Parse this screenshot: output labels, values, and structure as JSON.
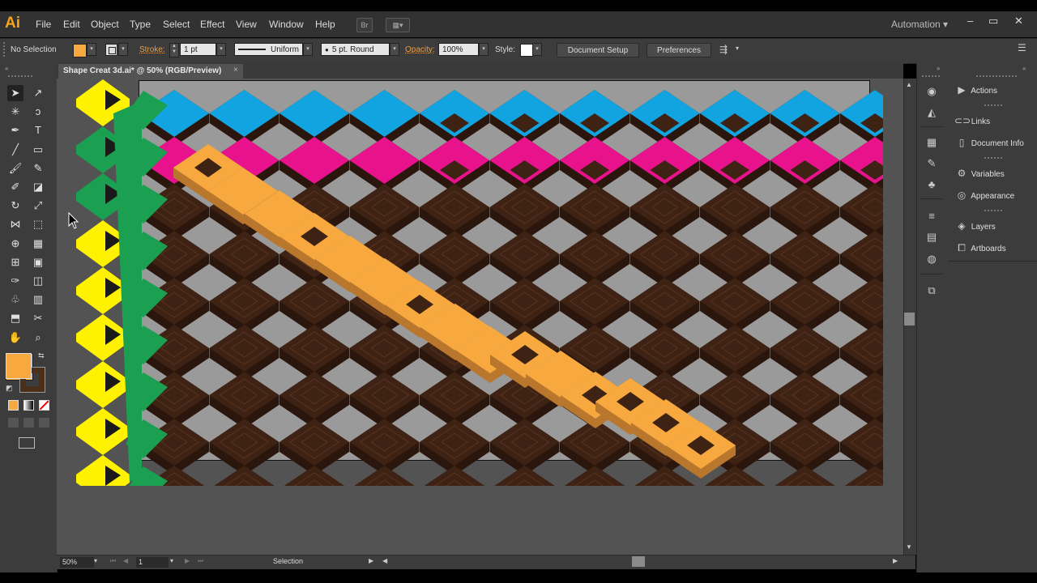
{
  "app": {
    "logo": "Ai"
  },
  "menu": [
    "File",
    "Edit",
    "Object",
    "Type",
    "Select",
    "Effect",
    "View",
    "Window",
    "Help"
  ],
  "menubar_buttons": {
    "bridge": "Br",
    "arrange": "▦▾"
  },
  "workspace": "Automation",
  "window_controls": {
    "minimize": "–",
    "restore": "▭",
    "close": "✕"
  },
  "control_bar": {
    "selection_label": "No Selection",
    "fill_color": "#f7a940",
    "stroke_label": "Stroke:",
    "stroke_weight": "1 pt",
    "profile": "Uniform",
    "brush": "5 pt. Round",
    "opacity_label": "Opacity:",
    "opacity": "100%",
    "style_label": "Style:",
    "document_setup": "Document Setup",
    "preferences": "Preferences"
  },
  "document": {
    "tab_title": "Shape Creat 3d.ai* @ 50% (RGB/Preview)",
    "tab_close": "×"
  },
  "status_bar": {
    "zoom": "50%",
    "artboard_number": "1",
    "tool_status": "Selection"
  },
  "toolbar": {
    "tools": [
      "selection-tool",
      "direct-selection-tool",
      "magic-wand-tool",
      "lasso-tool",
      "pen-tool",
      "type-tool",
      "line-tool",
      "rectangle-tool",
      "paintbrush-tool",
      "pencil-tool",
      "blob-brush-tool",
      "eraser-tool",
      "rotate-tool",
      "scale-tool",
      "width-tool",
      "free-transform-tool",
      "shape-builder-tool",
      "perspective-grid-tool",
      "mesh-tool",
      "gradient-tool",
      "eyedropper-tool",
      "blend-tool",
      "symbol-sprayer-tool",
      "column-graph-tool",
      "artboard-tool",
      "slice-tool",
      "hand-tool",
      "zoom-tool"
    ],
    "fill_swatch": "#f7a940",
    "stroke_swatch": "#4a2f1a"
  },
  "panels": [
    {
      "label": "Actions",
      "icon": "play-icon"
    },
    {
      "label": "Links",
      "icon": "link-icon"
    },
    {
      "label": "Document Info",
      "icon": "document-info-icon"
    },
    {
      "label": "Variables",
      "icon": "variables-icon"
    },
    {
      "label": "Appearance",
      "icon": "appearance-icon"
    },
    {
      "label": "Layers",
      "icon": "layers-icon"
    },
    {
      "label": "Artboards",
      "icon": "artboards-icon"
    }
  ],
  "artwork_colors": {
    "brown": "#3e2214",
    "brown_light": "#5a341f",
    "blue": "#12a4e0",
    "magenta": "#e8128c",
    "orange": "#f7a940",
    "yellow": "#fff200",
    "green": "#1aa050",
    "artboard": "#9a9a9a"
  }
}
